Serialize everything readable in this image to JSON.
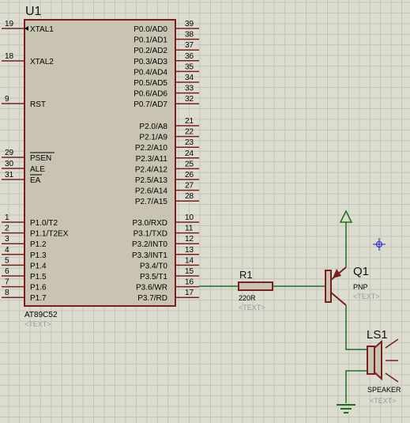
{
  "u1": {
    "ref": "U1",
    "part": "AT89C52",
    "text_placeholder": "<TEXT>",
    "left_pins_top": [
      {
        "num": "19",
        "name": "XTAL1"
      },
      {
        "num": "18",
        "name": "XTAL2"
      },
      {
        "num": "9",
        "name": "RST"
      }
    ],
    "left_pins_mid": [
      {
        "num": "29",
        "name": "PSEN"
      },
      {
        "num": "30",
        "name": "ALE"
      },
      {
        "num": "31",
        "name": "EA"
      }
    ],
    "left_pins_port1": [
      {
        "num": "1",
        "name": "P1.0/T2"
      },
      {
        "num": "2",
        "name": "P1.1/T2EX"
      },
      {
        "num": "3",
        "name": "P1.2"
      },
      {
        "num": "4",
        "name": "P1.3"
      },
      {
        "num": "5",
        "name": "P1.4"
      },
      {
        "num": "6",
        "name": "P1.5"
      },
      {
        "num": "7",
        "name": "P1.6"
      },
      {
        "num": "8",
        "name": "P1.7"
      }
    ],
    "right_pins_port0": [
      {
        "num": "39",
        "name": "P0.0/AD0"
      },
      {
        "num": "38",
        "name": "P0.1/AD1"
      },
      {
        "num": "37",
        "name": "P0.2/AD2"
      },
      {
        "num": "36",
        "name": "P0.3/AD3"
      },
      {
        "num": "35",
        "name": "P0.4/AD4"
      },
      {
        "num": "34",
        "name": "P0.5/AD5"
      },
      {
        "num": "33",
        "name": "P0.6/AD6"
      },
      {
        "num": "32",
        "name": "P0.7/AD7"
      }
    ],
    "right_pins_port2": [
      {
        "num": "21",
        "name": "P2.0/A8"
      },
      {
        "num": "22",
        "name": "P2.1/A9"
      },
      {
        "num": "23",
        "name": "P2.2/A10"
      },
      {
        "num": "24",
        "name": "P2.3/A11"
      },
      {
        "num": "25",
        "name": "P2.4/A12"
      },
      {
        "num": "26",
        "name": "P2.5/A13"
      },
      {
        "num": "27",
        "name": "P2.6/A14"
      },
      {
        "num": "28",
        "name": "P2.7/A15"
      }
    ],
    "right_pins_port3": [
      {
        "num": "10",
        "name": "P3.0/RXD"
      },
      {
        "num": "11",
        "name": "P3.1/TXD"
      },
      {
        "num": "12",
        "name": "P3.2/INT0"
      },
      {
        "num": "13",
        "name": "P3.3/INT1"
      },
      {
        "num": "14",
        "name": "P3.4/T0"
      },
      {
        "num": "15",
        "name": "P3.5/T1"
      },
      {
        "num": "16",
        "name": "P3.6/WR"
      },
      {
        "num": "17",
        "name": "P3.7/RD"
      }
    ]
  },
  "r1": {
    "ref": "R1",
    "value": "220R",
    "text_placeholder": "<TEXT>"
  },
  "q1": {
    "ref": "Q1",
    "type": "PNP",
    "text_placeholder": "<TEXT>"
  },
  "ls1": {
    "ref": "LS1",
    "type": "SPEAKER",
    "text_placeholder": "<TEXT>"
  },
  "colors": {
    "background": "#dcdcd0",
    "grid": "#c4c4b6",
    "chip_fill": "#c9c4b2",
    "outline": "#7a1e1e",
    "wire": "#1e6e1e",
    "text": "#000000",
    "ref_text": "#111111",
    "placeholder_text": "#9a9a9a",
    "marker": "#1e1ec8"
  }
}
